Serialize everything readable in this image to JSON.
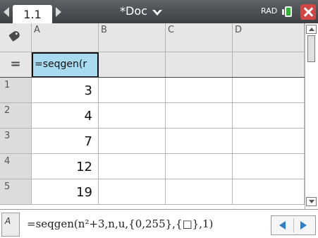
{
  "titlebar": {
    "tab_label": "1.1",
    "doc_title": "*Doc",
    "mode_label": "RAD"
  },
  "grid": {
    "columns": [
      "A",
      "B",
      "C",
      "D"
    ],
    "formula_marker": "=",
    "formula_cell": "=seqgen(r",
    "rows": [
      {
        "num": "1",
        "a": "3"
      },
      {
        "num": "2",
        "a": "4"
      },
      {
        "num": "3",
        "a": "7"
      },
      {
        "num": "4",
        "a": "12"
      },
      {
        "num": "5",
        "a": "19"
      }
    ]
  },
  "entry": {
    "cell_ref": "A",
    "expression": "=seqgen(n²+3,n,u,{0,255},{□},1)"
  },
  "colors": {
    "formula_cell_bg": "#a8dbf0",
    "close_button": "#d24545",
    "arrow_blue": "#2e7ec4",
    "battery_green": "#2fb42f"
  }
}
